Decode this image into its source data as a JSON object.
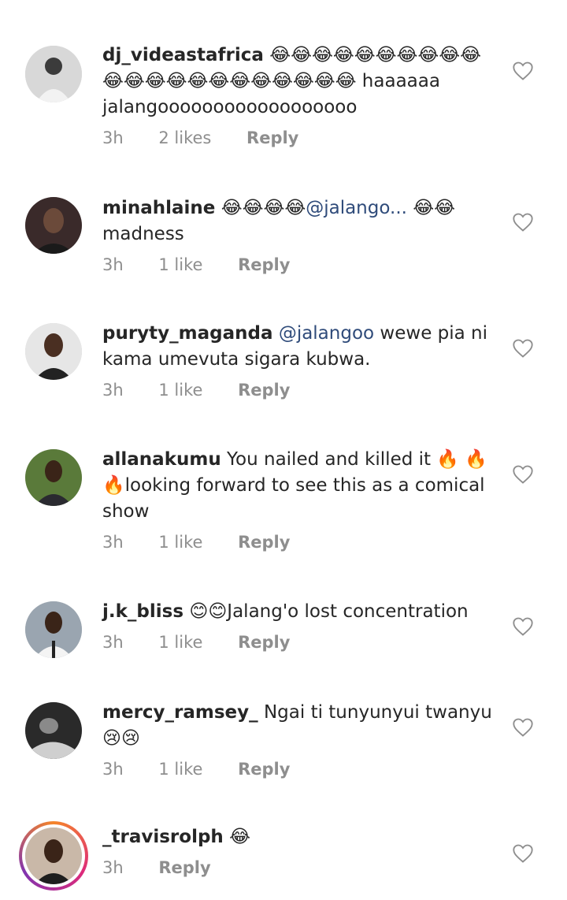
{
  "comments": [
    {
      "username": "dj_videastafrica",
      "text": "😂😂😂😂😂😂😂😂😂😂😂😂😂😂😂😂😂😂😂😂😂😂 haaaaaa jalangoooooooooooooooooo",
      "time": "3h",
      "likes": "2 likes",
      "reply": "Reply",
      "avatar_color": "#d8d8d8"
    },
    {
      "username": "minahlaine",
      "text_before": "😂😂😂😂",
      "mention": "@jalango...",
      "text": " 😂😂 madness",
      "time": "3h",
      "likes": "1 like",
      "reply": "Reply",
      "avatar_color": "#3a2a2a"
    },
    {
      "username": "puryty_maganda",
      "mention": "@jalangoo",
      "text": " wewe pia ni kama umevuta sigara kubwa.",
      "time": "3h",
      "likes": "1 like",
      "reply": "Reply",
      "avatar_color": "#e6e6e6"
    },
    {
      "username": "allanakumu",
      "text": "You nailed and killed it 🔥 🔥 🔥looking forward to see this as a comical show",
      "time": "3h",
      "likes": "1 like",
      "reply": "Reply",
      "avatar_color": "#5a7a3a"
    },
    {
      "username": "j.k_bliss",
      "text": "😊😊Jalang'o lost concentration",
      "time": "3h",
      "likes": "1 like",
      "reply": "Reply",
      "avatar_color": "#9aa5b0"
    },
    {
      "username": "mercy_ramsey_",
      "text": "Ngai ti tunyunyui twanyu 😢😢",
      "time": "3h",
      "likes": "1 like",
      "reply": "Reply",
      "avatar_color": "#2a2a2a"
    },
    {
      "username": "_travisrolph",
      "text": "😂",
      "time": "3h",
      "reply": "Reply",
      "avatar_color": "#c9b8a8",
      "has_story_ring": true
    }
  ],
  "icons": {
    "like": "heart-outline-icon"
  },
  "colors": {
    "username": "#262626",
    "mention": "#2f4b7a",
    "meta": "#8e8e8e",
    "heart_stroke": "#8e8e8e"
  }
}
